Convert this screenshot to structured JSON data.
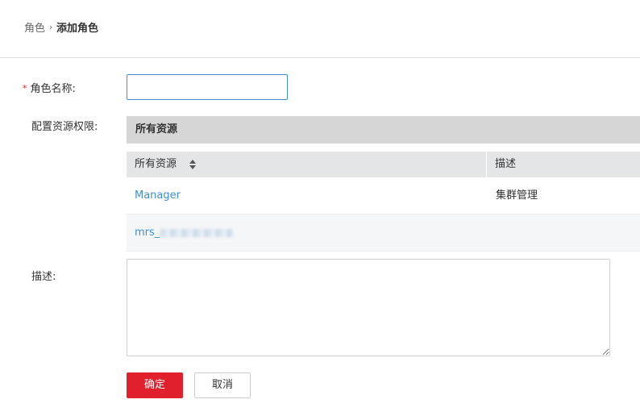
{
  "breadcrumb": {
    "parent": "角色",
    "separator": "›",
    "current": "添加角色"
  },
  "form": {
    "role_name_label": "角色名称:",
    "required_mark": "*",
    "role_name_value": "",
    "permissions_label": "配置资源权限:",
    "description_label": "描述:",
    "description_value": ""
  },
  "resources": {
    "panel_title": "所有资源",
    "columns": {
      "resource": "所有资源",
      "description": "描述"
    },
    "rows": [
      {
        "resource": "Manager",
        "description": "集群管理"
      },
      {
        "resource": "mrs_",
        "description": ""
      }
    ]
  },
  "buttons": {
    "confirm": "确定",
    "cancel": "取消"
  },
  "colors": {
    "accent": "#3f8fd2",
    "primary_button": "#e1202d",
    "required": "#e02020"
  },
  "icons": {
    "sort": "sort-icon",
    "breadcrumb_separator": "chevron-right-icon"
  }
}
